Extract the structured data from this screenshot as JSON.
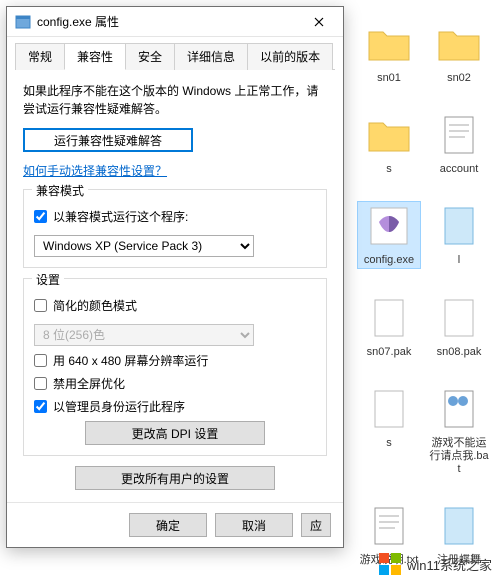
{
  "dialog": {
    "title": "config.exe 属性",
    "tabs": [
      "常规",
      "兼容性",
      "安全",
      "详细信息",
      "以前的版本"
    ],
    "active_tab_index": 1,
    "intro": "如果此程序不能在这个版本的 Windows 上正常工作，请尝试运行兼容性疑难解答。",
    "troubleshoot_btn": "运行兼容性疑难解答",
    "help_link": "如何手动选择兼容性设置？",
    "compat_group": {
      "title": "兼容模式",
      "checkbox": "以兼容模式运行这个程序:",
      "checked": true,
      "select_value": "Windows XP (Service Pack 3)"
    },
    "settings_group": {
      "title": "设置",
      "reduced_color": {
        "label": "简化的颜色模式",
        "checked": false
      },
      "color_select": "8 位(256)色",
      "lowres": {
        "label": "用 640 x 480 屏幕分辨率运行",
        "checked": false
      },
      "disable_fullscreen_opt": {
        "label": "禁用全屏优化",
        "checked": false
      },
      "run_as_admin": {
        "label": "以管理员身份运行此程序",
        "checked": true
      },
      "dpi_btn": "更改高 DPI 设置"
    },
    "all_users_btn": "更改所有用户的设置",
    "ok": "确定",
    "cancel": "取消",
    "apply": "应"
  },
  "desktop": {
    "files": [
      {
        "name": "sn01",
        "type": "folder"
      },
      {
        "name": "sn02",
        "type": "folder"
      },
      {
        "name": "s",
        "type": "folder"
      },
      {
        "name": "account",
        "type": "txt"
      },
      {
        "name": "config.exe",
        "type": "exe",
        "selected": true
      },
      {
        "name": "l",
        "type": "file"
      },
      {
        "name": "sn07.pak",
        "type": "pak"
      },
      {
        "name": "sn08.pak",
        "type": "pak"
      },
      {
        "name": "s",
        "type": "pak"
      },
      {
        "name": "游戏不能运行请点我.bat",
        "type": "bat"
      },
      {
        "name": "游戏说明.txt",
        "type": "txt"
      },
      {
        "name": "注册蝶舞",
        "type": "file"
      }
    ]
  },
  "watermark": "win11系统之家"
}
